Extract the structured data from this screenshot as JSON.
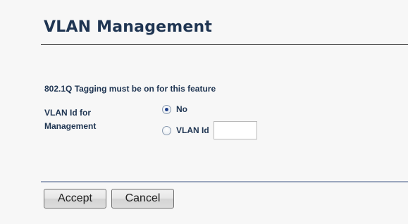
{
  "page": {
    "title": "VLAN Management"
  },
  "form": {
    "notice": "802.1Q Tagging must be on for this feature",
    "field_label_line1": "VLAN Id for",
    "field_label_line2": "Management",
    "options": [
      {
        "label": "No",
        "checked": true
      },
      {
        "label": "VLAN Id",
        "checked": false
      }
    ],
    "vlan_id_value": ""
  },
  "buttons": {
    "accept_label": "Accept",
    "cancel_label": "Cancel"
  },
  "colors": {
    "heading": "#1f3552",
    "background": "#f7f7f7",
    "divider": "#9aa6bd"
  }
}
